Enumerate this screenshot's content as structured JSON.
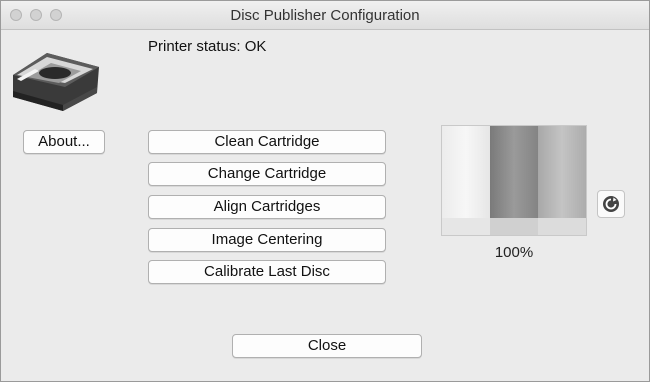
{
  "window": {
    "title": "Disc Publisher Configuration"
  },
  "status": {
    "text": "Printer status: OK"
  },
  "buttons": {
    "about": "About...",
    "actions": [
      "Clean Cartridge",
      "Change Cartridge",
      "Align Cartridges",
      "Image Centering",
      "Calibrate Last Disc"
    ],
    "close": "Close"
  },
  "ink": {
    "level_text": "100%",
    "level_fraction": 1.0
  },
  "icons": {
    "printer": "disc-publisher-printer-icon",
    "refresh": "refresh-icon"
  }
}
